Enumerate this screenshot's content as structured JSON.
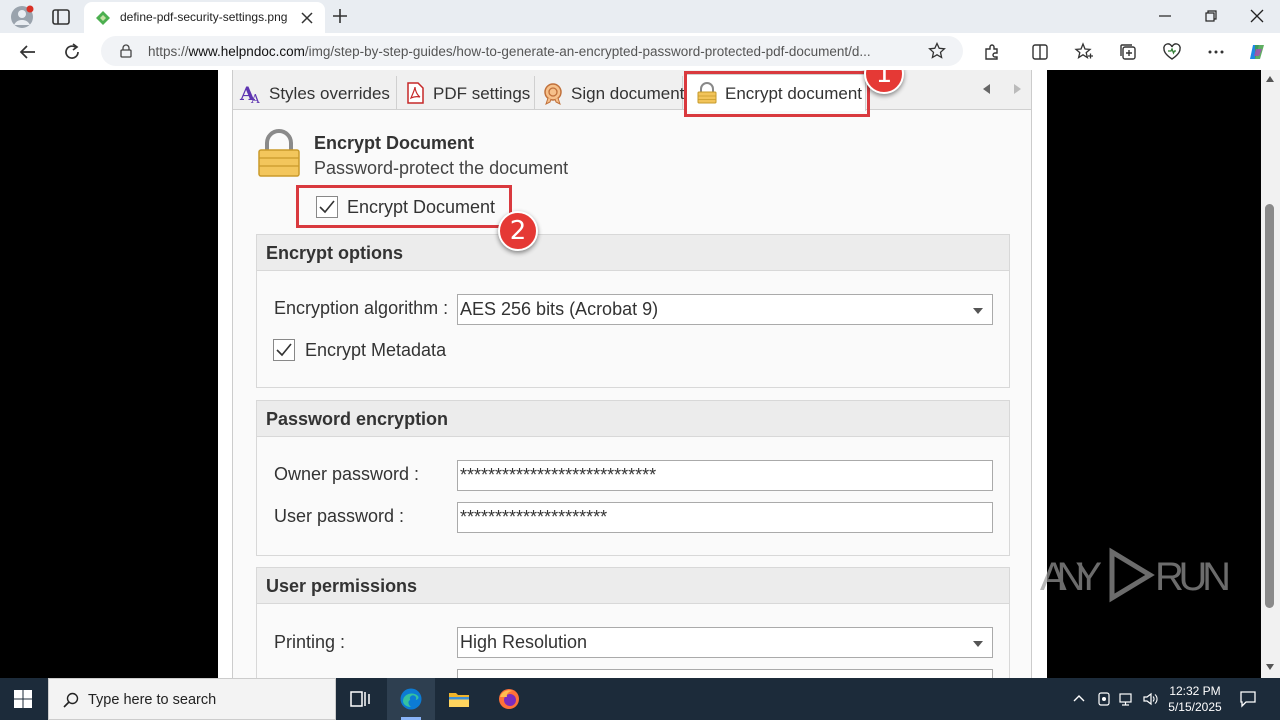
{
  "browser": {
    "tab_title": "define-pdf-security-settings.png",
    "url_prefix": "https://",
    "url_domain": "www.helpndoc.com",
    "url_path": "/img/step-by-step-guides/how-to-generate-an-encrypted-password-protected-pdf-document/d..."
  },
  "dialog": {
    "tabs": [
      {
        "label": "Styles overrides"
      },
      {
        "label": "PDF settings"
      },
      {
        "label": "Sign document"
      },
      {
        "label": "Encrypt document"
      }
    ],
    "header_title": "Encrypt Document",
    "header_subtitle": "Password-protect the document",
    "encrypt_checkbox_label": "Encrypt Document",
    "encrypt_options": {
      "title": "Encrypt options",
      "algorithm_label": "Encryption algorithm :",
      "algorithm_value": "AES 256 bits (Acrobat 9)",
      "metadata_label": "Encrypt Metadata"
    },
    "password_encryption": {
      "title": "Password encryption",
      "owner_label": "Owner password :",
      "owner_value": "****************************",
      "user_label": "User password :",
      "user_value": "*********************"
    },
    "user_permissions": {
      "title": "User permissions",
      "printing_label": "Printing :",
      "printing_value": "High Resolution"
    }
  },
  "annotations": {
    "badge1": "1",
    "badge2": "2",
    "color": "#d9393e"
  },
  "watermark": "ANY RUN",
  "taskbar": {
    "search_placeholder": "Type here to search",
    "time": "12:32 PM",
    "date": "5/15/2025"
  }
}
